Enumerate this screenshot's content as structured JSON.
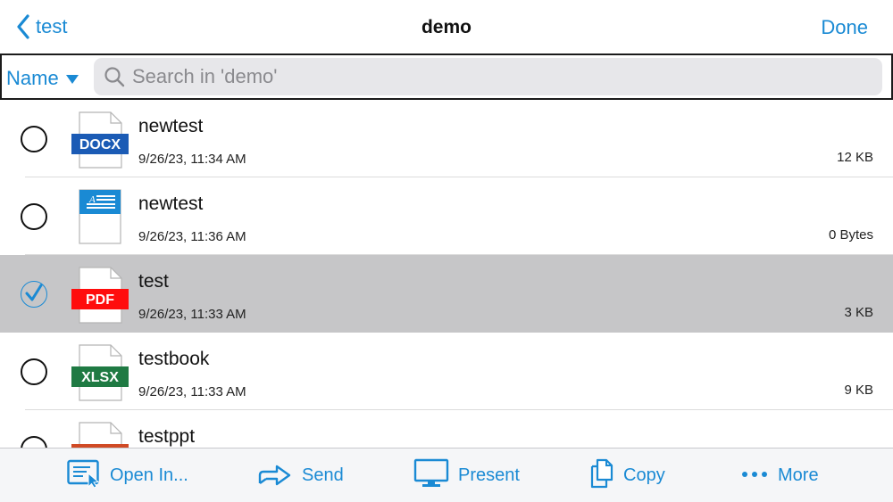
{
  "nav": {
    "back_label": "test",
    "title": "demo",
    "done_label": "Done"
  },
  "search": {
    "sort_label": "Name",
    "placeholder": "Search in 'demo'"
  },
  "files": [
    {
      "name": "newtest",
      "date": "9/26/23, 11:34 AM",
      "size": "12 KB",
      "type": "DOCX",
      "badge_color": "#1b5bb5",
      "selected": false
    },
    {
      "name": "newtest",
      "date": "9/26/23, 11:36 AM",
      "size": "0 Bytes",
      "type": "doc-generic",
      "badge_color": "#1a8ad4",
      "selected": false
    },
    {
      "name": "test",
      "date": "9/26/23, 11:33 AM",
      "size": "3 KB",
      "type": "PDF",
      "badge_color": "#ff0d0d",
      "selected": true
    },
    {
      "name": "testbook",
      "date": "9/26/23, 11:33 AM",
      "size": "9 KB",
      "type": "XLSX",
      "badge_color": "#1f7a43",
      "selected": false
    },
    {
      "name": "testppt",
      "date": "",
      "size": "",
      "type": "PPTX",
      "badge_color": "#d04a25",
      "selected": false
    }
  ],
  "toolbar": {
    "open_in": "Open In...",
    "send": "Send",
    "present": "Present",
    "copy": "Copy",
    "more": "More"
  },
  "colors": {
    "accent": "#1a8ad4",
    "selected_row": "#c6c6c8"
  }
}
